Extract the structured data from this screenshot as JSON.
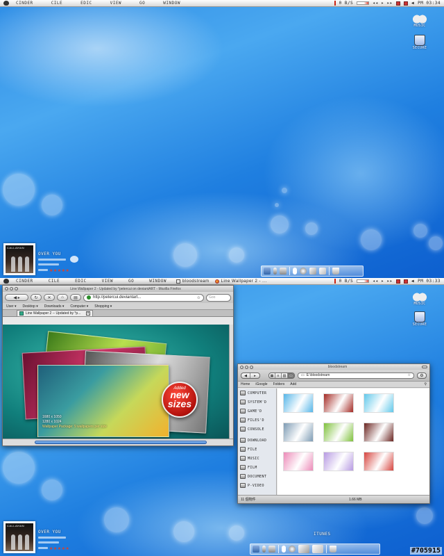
{
  "top_menubar": {
    "menus": [
      "CINDER",
      "CILE",
      "EDIC",
      "VIEW",
      "GO",
      "WINDOW"
    ],
    "status_speed": "0 B/S",
    "clock": "PM 03:34"
  },
  "bottom_menubar": {
    "menus": [
      "CINDER",
      "CILE",
      "EDIC",
      "VIEW",
      "GO",
      "WINDOW"
    ],
    "tasks": [
      "bloodstream",
      "Line Wallpaper 2 - ..."
    ],
    "status_speed": "0 B/S",
    "clock": "PM 03:33"
  },
  "desktop_icons": [
    "MUSIC",
    "SECURE"
  ],
  "now_playing": {
    "band": "CALLAHAN",
    "track": "OVER YOU",
    "stars": "★★★★★"
  },
  "firefox": {
    "title": "Line Wallpaper 2 - Updated by *petercui on deviantART - Mozilla Firefox",
    "url": "http://petercui.deviantart...",
    "search_placeholder": "Goo",
    "bookmarks": [
      "User",
      "Desktop",
      "Downloads",
      "Computer",
      "Shopping"
    ],
    "tab_title": "Line Wallpaper 2 -- Updated by *p...",
    "badge_added": "Added",
    "badge_line1": "new",
    "badge_line2": "sizes",
    "info_lines": [
      "1680 x 1050",
      "1280 x 1024",
      "Wallpaper Package: 9 wallpapers per size"
    ]
  },
  "finder": {
    "title": "bloodstream",
    "path": "E:\\bloodstream",
    "bar_items": [
      "Home",
      "iGoogle",
      "Folders",
      "Add"
    ],
    "sidebar": [
      "COMPUTER",
      "SYSTEM'D",
      "GAME'D",
      "FILES'D",
      "CONSOLE",
      "DOWNLOAD",
      "FILE",
      "MUSIC",
      "FILM",
      "DOCUMENT",
      "P-VIDEO"
    ],
    "item_count": "11 個物件",
    "size": "1.66 MB",
    "thumb_colors": [
      "#56b6e8",
      "#a42a24",
      "#61c8ea",
      "#7d9bb4",
      "#7fc13c",
      "#6a2420",
      "#ec8ab8",
      "#b79ae2",
      "#d6443e"
    ]
  },
  "dock_label": "ITUNES",
  "watermark": "#705915"
}
